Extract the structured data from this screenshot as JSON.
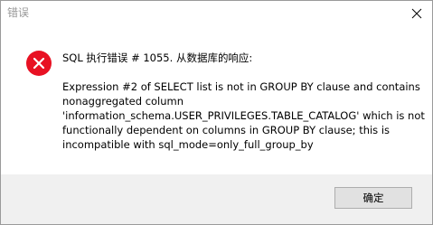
{
  "window": {
    "title": "错误"
  },
  "dialog": {
    "header": "SQL 执行错误 # 1055. 从数据库的响应:",
    "message_lines": [
      "Expression #2 of SELECT list is not in GROUP BY clause and contains",
      "nonaggregated column",
      "'information_schema.USER_PRIVILEGES.TABLE_CATALOG' which is not",
      "functionally dependent on columns in GROUP BY clause; this is",
      "incompatible with sql_mode=only_full_group_by"
    ]
  },
  "buttons": {
    "ok_label": "确定"
  },
  "icons": {
    "close": "close-icon",
    "error": "error-icon"
  },
  "colors": {
    "error_red": "#e81123",
    "footer_bg": "#f0f0f0",
    "button_bg": "#e1e1e1",
    "button_border": "#adadad",
    "title_text": "#999999"
  }
}
